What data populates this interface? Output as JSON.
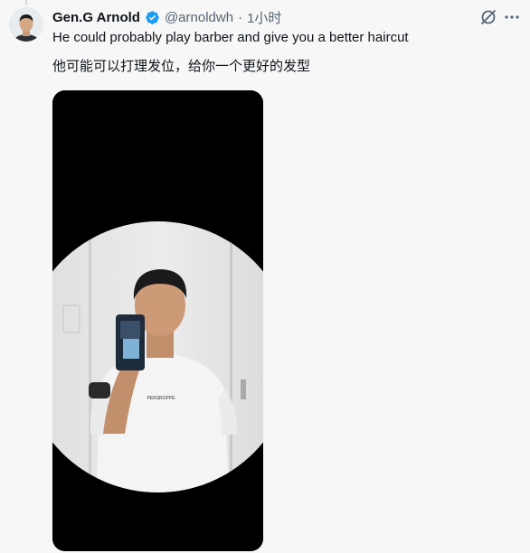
{
  "post": {
    "author_name": "Gen.G Arnold",
    "handle": "@arnoldwh",
    "separator": "·",
    "time": "1小时",
    "text_en": "He could probably play barber and give you a better haircut",
    "text_zh": "他可能可以打理发位，给你一个更好的发型",
    "shirt_print": "PERSROPPE"
  },
  "icons": {
    "verified": "verified-badge-icon",
    "grok": "grok-icon",
    "more": "more-icon"
  },
  "colors": {
    "background": "#f7f7f8",
    "verified_blue": "#1d9bf0",
    "secondary_text": "#536471",
    "media_bg": "#000000"
  }
}
